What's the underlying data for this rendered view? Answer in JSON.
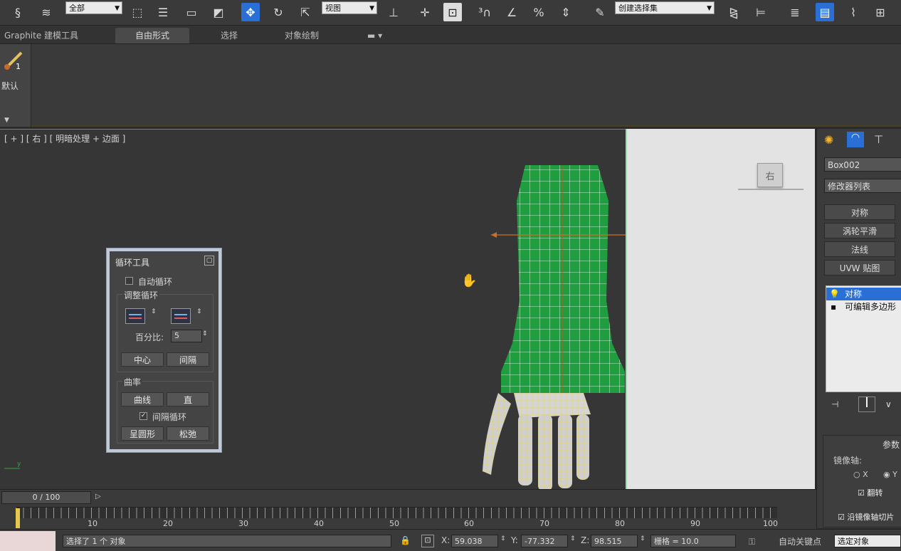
{
  "toolbar": {
    "selection_filter": "全部",
    "ref_coord": "视图",
    "named_selection": "创建选择集",
    "icons": [
      "link-icon",
      "unlink-icon",
      "bind-space-warp-icon",
      "select-object-icon",
      "select-by-name-icon",
      "rect-select-icon",
      "window-crossing-icon",
      "select-move-icon",
      "select-rotate-icon",
      "select-scale-icon",
      "pivot-icon",
      "manipulate-icon",
      "keyboard-shortcut-icon",
      "snaps-toggle-icon",
      "angle-snap-icon",
      "percent-snap-icon",
      "spinner-snap-icon",
      "edit-named-sel-icon",
      "mirror-icon",
      "align-icon",
      "layer-manager-icon",
      "graphite-icon",
      "curve-editor-icon",
      "schematic-view-icon"
    ]
  },
  "ribbon": {
    "tabs": [
      "Graphite 建模工具",
      "自由形式",
      "选择",
      "对象绘制"
    ],
    "brush_label": "默认"
  },
  "viewport": {
    "label": "[ + ] [ 右 ] [ 明暗处理 + 边面 ]",
    "viewcube_label": "右"
  },
  "loop_panel": {
    "title": "循环工具",
    "auto_loop": "自动循环",
    "adjust_group": "调整循环",
    "percent_label": "百分比:",
    "percent_value": "5",
    "center_btn": "中心",
    "spacing_btn": "间隔",
    "curvature_group": "曲率",
    "curve_btn": "曲线",
    "straight_btn": "直",
    "space_loop": "间隔循环",
    "circle_btn": "呈圆形",
    "relax_btn": "松弛"
  },
  "command_panel": {
    "object_name": "Box002",
    "modifier_list": "修改器列表",
    "buttons": [
      "对称",
      "涡轮平滑",
      "法线",
      "UVW 贴图"
    ],
    "stack": [
      "对称",
      "可编辑多边形"
    ],
    "params_title": "参数",
    "mirror_axis": "镜像轴:",
    "axis_x": "X",
    "axis_y": "Y",
    "flip": "翻转",
    "slice": "沿镜像轴切片"
  },
  "timeline": {
    "frame_display": "0 / 100",
    "ticks": [
      "10",
      "20",
      "30",
      "40",
      "50",
      "60",
      "70",
      "80",
      "90",
      "100"
    ]
  },
  "statusbar": {
    "message": "选择了 1 个 对象",
    "x_label": "X:",
    "x_value": "59.038",
    "y_label": "Y:",
    "y_value": "-77.332",
    "z_label": "Z:",
    "z_value": "98.515",
    "grid": "栅格 = 10.0",
    "autokey": "自动关键点",
    "selected_object": "选定对象"
  }
}
